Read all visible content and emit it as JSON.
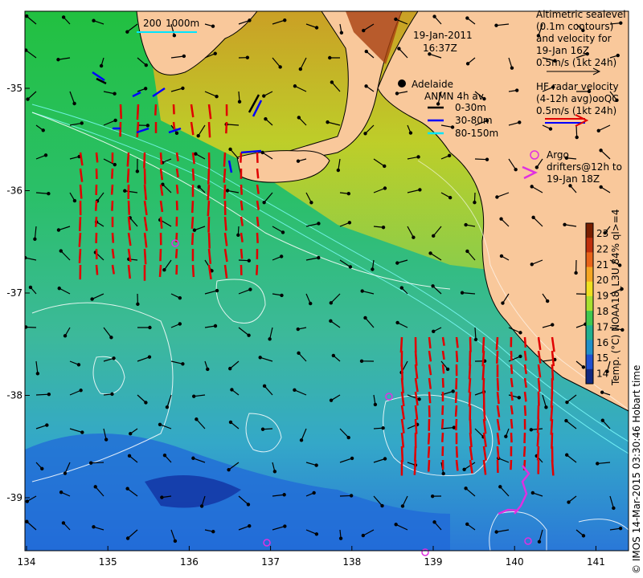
{
  "map": {
    "datetime": [
      "19-Jan-2011",
      "16:37Z"
    ],
    "scale": {
      "left": "200",
      "right": "1000m"
    },
    "city": "Adelaide",
    "lon_ticks": [
      "134",
      "135",
      "136",
      "137",
      "138",
      "139",
      "140",
      "141"
    ],
    "lat_ticks": [
      "-35",
      "-36",
      "-37",
      "-38",
      "-39"
    ],
    "altimetry_legend": [
      "Altimetric sealevel",
      "(0.1m contours)",
      "and velocity for",
      "19-Jan 16Z",
      "0.5m/s (1kt 24h)"
    ],
    "hf_legend": [
      "HF radar velocity",
      "(4-12h avg)ooQC",
      "0.5m/s (1kt 24h)"
    ],
    "anmn": {
      "title": "ANMN 4h av.",
      "items": [
        {
          "label": "0-30m",
          "color": "#000000"
        },
        {
          "label": "30-80m",
          "color": "#0000ff"
        },
        {
          "label": "80-150m",
          "color": "#00e5ff"
        }
      ]
    },
    "argo": [
      "Argo",
      "drifters@12h to",
      "19-Jan 18Z"
    ],
    "colorbar": {
      "ticks": [
        "23",
        "22",
        "21",
        "20",
        "19",
        "18",
        "17",
        "16",
        "15",
        "14"
      ],
      "label": "Temp. (°C) NOAA18_L3U 84% ql>=4",
      "colors": [
        "#7a1f00",
        "#c0300d",
        "#e8641a",
        "#f5a623",
        "#f0e020",
        "#a8e030",
        "#40c850",
        "#20b090",
        "#2090c8",
        "#2050d0",
        "#102880"
      ]
    },
    "credit": "© IMOS 14-Mar-2015 03:30:46 Hobart time",
    "colors": {
      "land": "#f9c89b",
      "ocean": "#2bb86a",
      "hf": "#e00000",
      "argo": "#e030e0"
    }
  }
}
